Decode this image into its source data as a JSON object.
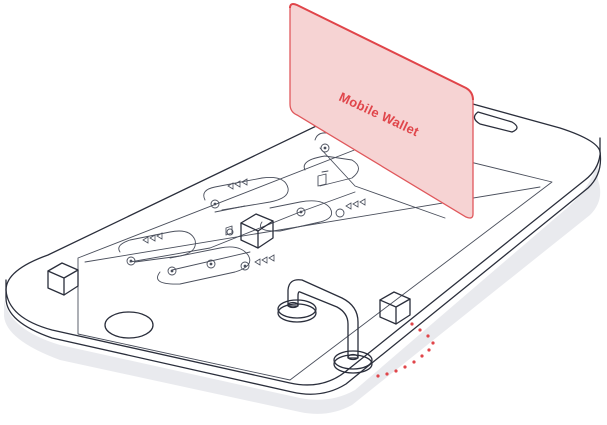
{
  "card": {
    "label": "Mobile Wallet"
  },
  "colors": {
    "card_fill": "#f6d3d3",
    "card_stroke": "#e0585c",
    "card_text": "#e0454a",
    "line": "#2a2e3b",
    "screen_line": "#4a4f5c",
    "shadow": "#e9eaee",
    "dots": "#e0454a"
  },
  "icons": [
    "phone-icon",
    "cube-icon",
    "pipe-icon",
    "card-icon",
    "node-icon",
    "triangle-marker-icon"
  ]
}
